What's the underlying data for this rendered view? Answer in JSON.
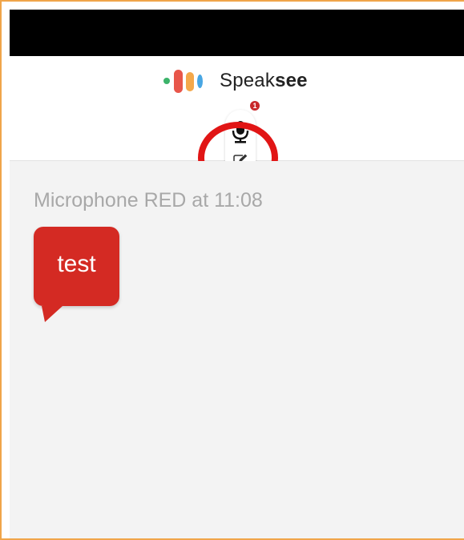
{
  "app": {
    "brand_prefix": "Speak",
    "brand_suffix": "see",
    "logo_colors": [
      "#3bb36a",
      "#e8564a",
      "#f4a84a",
      "#48a6e3"
    ]
  },
  "controls": {
    "notification_count": "1",
    "badge_color": "#c8282b",
    "mic_icon": "microphone-icon",
    "edit_icon": "edit-note-icon",
    "highlight_color": "#e11515"
  },
  "conversation": {
    "messages": [
      {
        "meta": "Microphone RED at 11:08",
        "text": "test",
        "color": "#d42a23"
      }
    ]
  }
}
